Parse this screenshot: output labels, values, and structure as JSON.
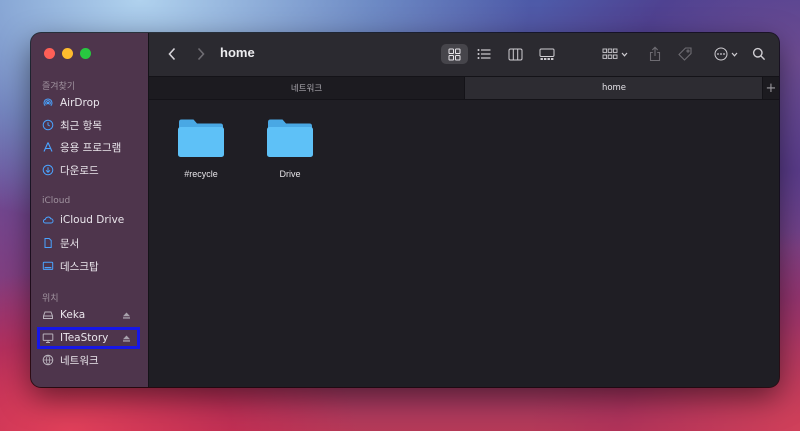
{
  "window": {
    "title": "home"
  },
  "sidebar": {
    "sections": [
      {
        "header": "즐겨찾기",
        "items": [
          {
            "label": "AirDrop",
            "icon": "airdrop-icon"
          },
          {
            "label": "최근 항목",
            "icon": "clock-icon"
          },
          {
            "label": "응용 프로그램",
            "icon": "applications-icon"
          },
          {
            "label": "다운로드",
            "icon": "download-icon"
          }
        ]
      },
      {
        "header": "iCloud",
        "items": [
          {
            "label": "iCloud Drive",
            "icon": "cloud-icon"
          },
          {
            "label": "문서",
            "icon": "document-icon"
          },
          {
            "label": "데스크탑",
            "icon": "desktop-icon"
          }
        ]
      },
      {
        "header": "위치",
        "items": [
          {
            "label": "Keka",
            "icon": "drive-icon",
            "ejectable": true
          },
          {
            "label": "ITeaStory",
            "icon": "monitor-icon",
            "ejectable": true,
            "highlighted": true
          },
          {
            "label": "네트워크",
            "icon": "network-icon"
          }
        ]
      }
    ]
  },
  "toolbar": {
    "back_icon": "chevron-left-icon",
    "forward_icon": "chevron-right-icon",
    "view_modes": [
      "icon-view",
      "list-view",
      "column-view",
      "gallery-view"
    ],
    "active_view": "icon-view"
  },
  "tabs": [
    {
      "label": "네트워크",
      "active": false
    },
    {
      "label": "home",
      "active": true
    }
  ],
  "tab_add_label": "+",
  "files": [
    {
      "name": "#recycle",
      "type": "folder"
    },
    {
      "name": "Drive",
      "type": "folder"
    }
  ],
  "colors": {
    "folder": "#5ec1f7",
    "highlight_border": "#1717e6",
    "sidebar_icon": "#4aa3ff"
  }
}
